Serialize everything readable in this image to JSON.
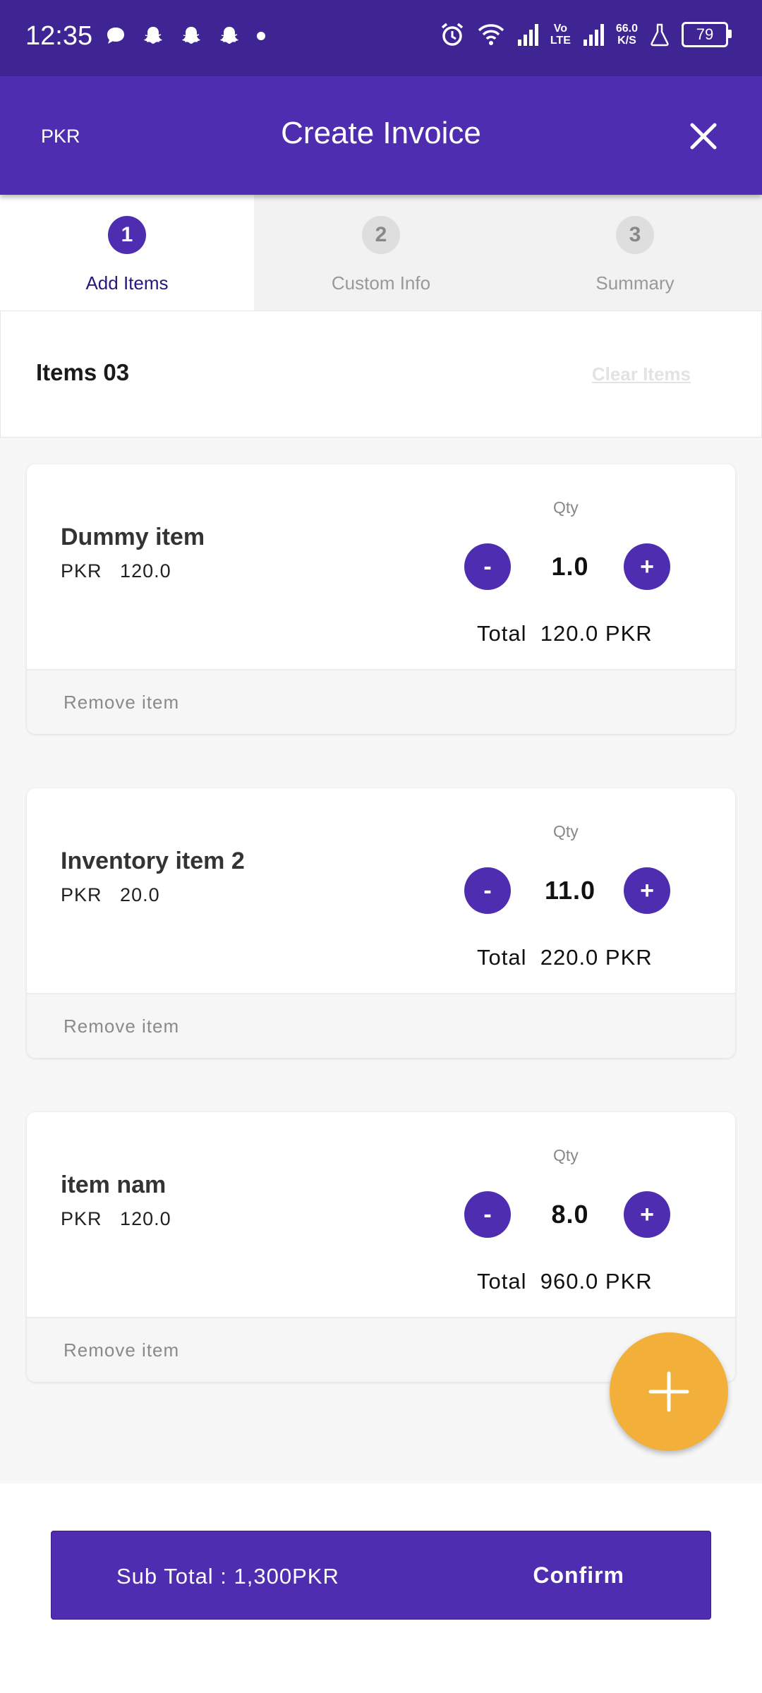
{
  "status_bar": {
    "time": "12:35",
    "speed_value": "66.0",
    "speed_unit": "K/S",
    "network_label_top": "Vo",
    "network_label_bottom": "LTE",
    "battery": "79"
  },
  "app_bar": {
    "currency": "PKR",
    "title": "Create Invoice"
  },
  "stepper": [
    {
      "number": "1",
      "label": "Add Items"
    },
    {
      "number": "2",
      "label": "Custom Info"
    },
    {
      "number": "3",
      "label": "Summary"
    }
  ],
  "items_header": {
    "count_label": "Items 03",
    "clear_label": "Clear Items"
  },
  "items": [
    {
      "name": "Dummy item",
      "currency": "PKR",
      "price": "120.0",
      "qty_label": "Qty",
      "minus": "-",
      "qty": "1.0",
      "plus": "+",
      "total_label": "Total",
      "total": "120.0 PKR",
      "remove_label": "Remove item"
    },
    {
      "name": "Inventory item 2",
      "currency": "PKR",
      "price": "20.0",
      "qty_label": "Qty",
      "minus": "-",
      "qty": "11.0",
      "plus": "+",
      "total_label": "Total",
      "total": "220.0 PKR",
      "remove_label": "Remove item"
    },
    {
      "name": "item nam",
      "currency": "PKR",
      "price": "120.0",
      "qty_label": "Qty",
      "minus": "-",
      "qty": "8.0",
      "plus": "+",
      "total_label": "Total",
      "total": "960.0 PKR",
      "remove_label": "Remove item"
    }
  ],
  "footer": {
    "subtotal": "Sub Total : 1,300PKR",
    "confirm_label": "Confirm"
  },
  "colors": {
    "primary": "#4f2db0",
    "status_bar": "#3f2594",
    "fab": "#f2af3a"
  },
  "icons": {
    "close": "close-icon",
    "fab": "plus-icon"
  }
}
